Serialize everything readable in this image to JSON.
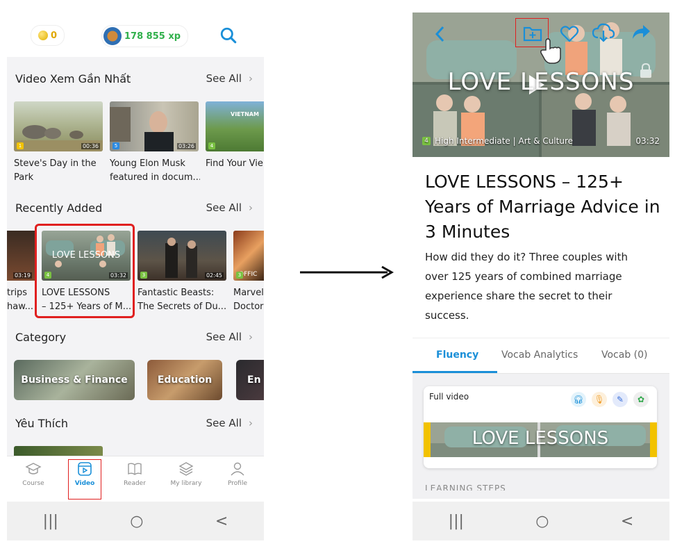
{
  "left": {
    "coins": "0",
    "xp": "178 855 xp",
    "sections": {
      "recent_watched": {
        "title": "Video Xem Gần Nhất",
        "see_all": "See All"
      },
      "recently_added": {
        "title": "Recently Added",
        "see_all": "See All"
      },
      "category": {
        "title": "Category",
        "see_all": "See All"
      },
      "favorites": {
        "title": "Yêu Thích",
        "see_all": "See All"
      }
    },
    "watched": [
      {
        "title1": "Steve's Day in the",
        "title2": "Park",
        "duration": "00:36",
        "level": "1",
        "level_color": "#f2c200"
      },
      {
        "title1": "Young Elon Musk",
        "title2": "featured in docum...",
        "duration": "03:26",
        "level": "5",
        "level_color": "#2c8ae0"
      },
      {
        "title1": "Find Your Vie",
        "title2": "",
        "duration": "",
        "level": "4",
        "level_color": "#7ac142",
        "overlay": "VIETNAM"
      }
    ],
    "added": [
      {
        "title1": "trips",
        "title2": "haw...",
        "duration": "03:19",
        "level": "",
        "level_color": "#7ac142"
      },
      {
        "title1": "LOVE LESSONS",
        "title2": "– 125+ Years of M...",
        "duration": "03:32",
        "level": "4",
        "level_color": "#7ac142",
        "overlay": "LOVE LESSONS"
      },
      {
        "title1": "Fantastic Beasts:",
        "title2": "The Secrets of Du...",
        "duration": "02:45",
        "level": "3",
        "level_color": "#7ac142"
      },
      {
        "title1": "Marvel",
        "title2": "Doctor",
        "duration": "",
        "level": "3",
        "level_color": "#7ac142",
        "overlay": "OFFIC"
      }
    ],
    "categories": [
      "Business & Finance",
      "Education",
      "En"
    ],
    "nav": [
      {
        "label": "Course",
        "icon": "graduation-cap-icon"
      },
      {
        "label": "Video",
        "icon": "video-icon"
      },
      {
        "label": "Reader",
        "icon": "book-icon"
      },
      {
        "label": "My library",
        "icon": "layers-icon"
      },
      {
        "label": "Profile",
        "icon": "user-icon"
      }
    ],
    "sys": [
      "|||",
      "○",
      "<"
    ]
  },
  "right": {
    "hero_overlay": "LOVE LESSONS",
    "level": "4",
    "meta": "High Intermediate | Art & Culture",
    "duration": "03:32",
    "title": "LOVE LESSONS – 125+ Years of Marriage Advice in 3 Minutes",
    "description": "How did they do it?  Three couples with over 125 years of combined marriage experience share the secret to their success.",
    "tabs": [
      "Fluency",
      "Vocab Analytics",
      "Vocab (0)"
    ],
    "full_video_label": "Full video",
    "strip_overlay": "LOVE LESSONS",
    "footer_cut": "LEARNING STEPS"
  },
  "colors": {
    "accent": "#1a8fd8",
    "highlight": "#e02020",
    "xp_green": "#31b04c"
  }
}
